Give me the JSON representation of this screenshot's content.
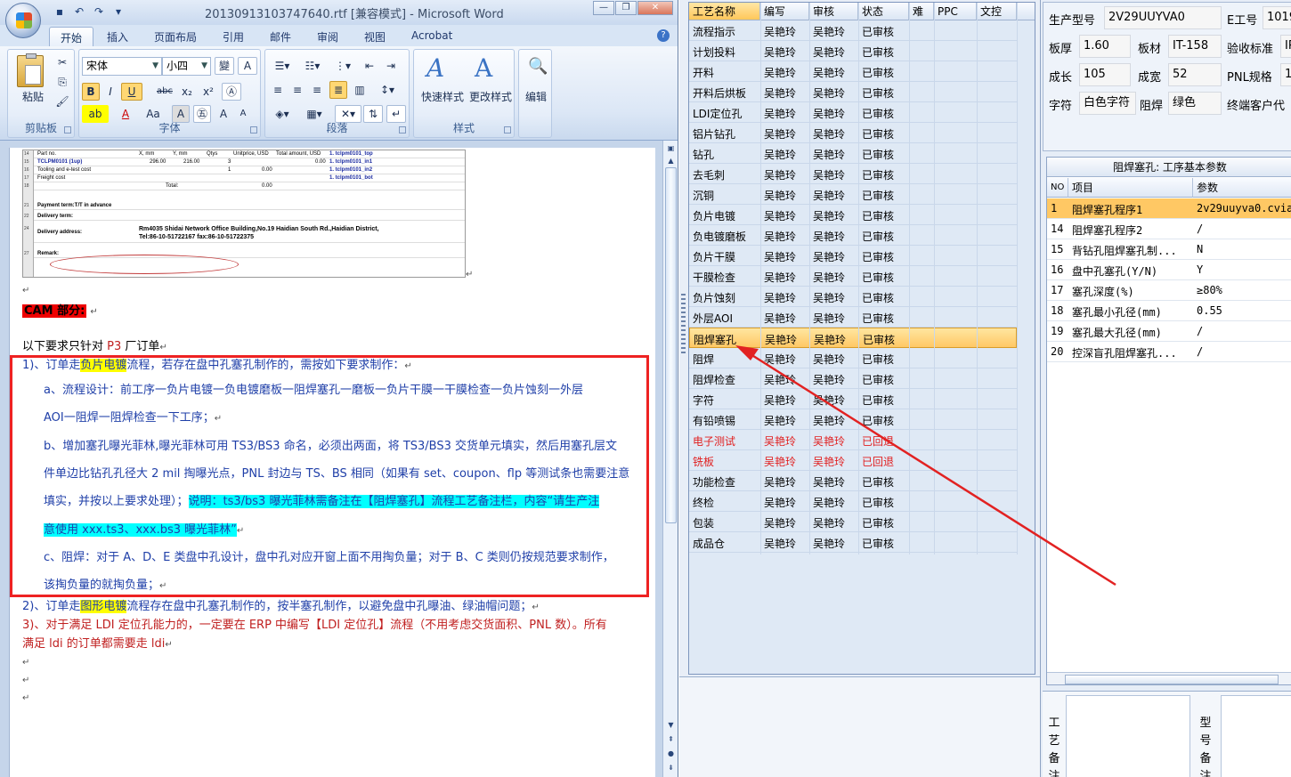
{
  "word": {
    "title": "20130913103747640.rtf [兼容模式] - Microsoft Word",
    "tabs": [
      "开始",
      "插入",
      "页面布局",
      "引用",
      "邮件",
      "审阅",
      "视图",
      "Acrobat"
    ],
    "active_tab": "开始",
    "ribbon": {
      "paste": "粘贴",
      "clipboard": "剪贴板",
      "font_name": "宋体",
      "font_size": "小四",
      "font_group": "字体",
      "paragraph_group": "段落",
      "quick_styles": "快速样式",
      "change_styles": "更改样式",
      "styles_group": "样式",
      "edit": "编辑",
      "bold": "B",
      "italic": "I",
      "underline": "U",
      "strike": "abc",
      "sub": "x₂",
      "sup": "x²",
      "font_color": "A",
      "case": "Aa",
      "grow": "A",
      "shrink": "A"
    },
    "sheet": {
      "rows": [
        {
          "n": "14",
          "cells": [
            "Part no.",
            "X, mm",
            "Y, mm",
            "Qtys",
            "Unitprice, USD",
            "Total amount, USD",
            "1. tclpm0101_top"
          ]
        },
        {
          "n": "15",
          "cells": [
            "TCLPM0101 (1up)",
            "296.00",
            "216.00",
            "3",
            "",
            "0.00",
            "1. tclpm0101_in1"
          ]
        },
        {
          "n": "16",
          "cells": [
            "Tooling and e-test cost",
            "",
            "",
            "1",
            "0.00",
            "",
            "1. tclpm0101_in2"
          ]
        },
        {
          "n": "17",
          "cells": [
            "Freight cost",
            "",
            "",
            "",
            "",
            "",
            "1. tclpm0101_bot"
          ]
        },
        {
          "n": "18",
          "cells": [
            "",
            "Total:",
            "",
            "0.00"
          ]
        },
        {
          "n": "21",
          "cells": [
            "Payment term:T/T in advance"
          ]
        },
        {
          "n": "22",
          "cells": [
            "Delivery term:"
          ]
        },
        {
          "n": "24",
          "cells": [
            "Delivery address:",
            "Rm4035 Shidai Network Office Building,No.19 Haidian South Rd.,Haidian District,",
            "Tel:86-10-51722167 fax:86-10-51722375"
          ]
        },
        {
          "n": "27",
          "cells": [
            "Remark:"
          ]
        }
      ]
    },
    "doc": {
      "cam_label": "CAM 部分:",
      "line_p3_prefix": "以下要求只针对 ",
      "line_p3_red": "P3",
      "line_p3_suffix": " 厂订单",
      "item1_prefix": "1)、订单走",
      "item1_hl": "负片电镀",
      "item1_suffix": "流程，若存在盘中孔塞孔制作的，需按如下要求制作：",
      "a_line1": "a、流程设计：前工序一负片电镀一负电镀磨板一阻焊塞孔一磨板一负片干膜一干膜检查一负片蚀刻一外层",
      "a_line2": "AOI一阻焊一阻焊检查一下工序；",
      "b_line1": "b、增加塞孔曝光菲林,曝光菲林可用 TS3/BS3 命名，必须出两面，将 TS3/BS3 交货单元填实，然后用塞孔层文",
      "b_line2": "件单边比钻孔孔径大 2 mil 掏曝光点，PNL 封边与 TS、BS 相同（如果有 set、coupon、flp 等测试条也需要注意",
      "b_line3_plain": "填实，并按以上要求处理）；",
      "b_line3_cyan": "说明：ts3/bs3 曝光菲林需备注在【阻焊塞孔】流程工艺备注栏，内容“请生产注",
      "b_line4_cyan": "意使用 xxx.ts3、xxx.bs3 曝光菲林”",
      "c_line1": "c、阻焊：对于 A、D、E 类盘中孔设计，盘中孔对应开窗上面不用掏负量；对于 B、C 类则仍按规范要求制作，",
      "c_line2": "该掏负量的就掏负量；",
      "item2_prefix": "2)、订单走",
      "item2_hl": "图形电镀",
      "item2_suffix": "流程存在盘中孔塞孔制作的，按半塞孔制作，以避免盘中孔曝油、绿油帽问题；",
      "item3_line1": "3)、对于满足 LDI 定位孔能力的，一定要在 ERP 中编写【LDI 定位孔】流程（不用考虑交货面积、PNL 数）。所有",
      "item3_line2": "满足 ldi 的订单都需要走 ldi"
    }
  },
  "process_grid": {
    "headers": [
      "工艺名称",
      "编写",
      "审核",
      "状态",
      "难",
      "PPC",
      "文控"
    ],
    "rows": [
      {
        "name": "流程指示",
        "writer": "吴艳玲",
        "reviewer": "吴艳玲",
        "status": "已审核"
      },
      {
        "name": "计划投料",
        "writer": "吴艳玲",
        "reviewer": "吴艳玲",
        "status": "已审核"
      },
      {
        "name": "开料",
        "writer": "吴艳玲",
        "reviewer": "吴艳玲",
        "status": "已审核"
      },
      {
        "name": "开料后烘板",
        "writer": "吴艳玲",
        "reviewer": "吴艳玲",
        "status": "已审核"
      },
      {
        "name": "LDI定位孔",
        "writer": "吴艳玲",
        "reviewer": "吴艳玲",
        "status": "已审核"
      },
      {
        "name": "铝片钻孔",
        "writer": "吴艳玲",
        "reviewer": "吴艳玲",
        "status": "已审核"
      },
      {
        "name": "钻孔",
        "writer": "吴艳玲",
        "reviewer": "吴艳玲",
        "status": "已审核"
      },
      {
        "name": "去毛刺",
        "writer": "吴艳玲",
        "reviewer": "吴艳玲",
        "status": "已审核"
      },
      {
        "name": "沉铜",
        "writer": "吴艳玲",
        "reviewer": "吴艳玲",
        "status": "已审核"
      },
      {
        "name": "负片电镀",
        "writer": "吴艳玲",
        "reviewer": "吴艳玲",
        "status": "已审核"
      },
      {
        "name": "负电镀磨板",
        "writer": "吴艳玲",
        "reviewer": "吴艳玲",
        "status": "已审核"
      },
      {
        "name": "负片干膜",
        "writer": "吴艳玲",
        "reviewer": "吴艳玲",
        "status": "已审核"
      },
      {
        "name": "干膜检查",
        "writer": "吴艳玲",
        "reviewer": "吴艳玲",
        "status": "已审核"
      },
      {
        "name": "负片蚀刻",
        "writer": "吴艳玲",
        "reviewer": "吴艳玲",
        "status": "已审核"
      },
      {
        "name": "外层AOI",
        "writer": "吴艳玲",
        "reviewer": "吴艳玲",
        "status": "已审核"
      },
      {
        "name": "阻焊塞孔",
        "writer": "吴艳玲",
        "reviewer": "吴艳玲",
        "status": "已审核"
      },
      {
        "name": "阻焊",
        "writer": "吴艳玲",
        "reviewer": "吴艳玲",
        "status": "已审核"
      },
      {
        "name": "阻焊检查",
        "writer": "吴艳玲",
        "reviewer": "吴艳玲",
        "status": "已审核"
      },
      {
        "name": "字符",
        "writer": "吴艳玲",
        "reviewer": "吴艳玲",
        "status": "已审核"
      },
      {
        "name": "有铅喷锡",
        "writer": "吴艳玲",
        "reviewer": "吴艳玲",
        "status": "已审核"
      },
      {
        "name": "电子测试",
        "writer": "吴艳玲",
        "reviewer": "吴艳玲",
        "status": "已回退"
      },
      {
        "name": "铣板",
        "writer": "吴艳玲",
        "reviewer": "吴艳玲",
        "status": "已回退"
      },
      {
        "name": "功能检查",
        "writer": "吴艳玲",
        "reviewer": "吴艳玲",
        "status": "已审核"
      },
      {
        "name": "终检",
        "writer": "吴艳玲",
        "reviewer": "吴艳玲",
        "status": "已审核"
      },
      {
        "name": "包装",
        "writer": "吴艳玲",
        "reviewer": "吴艳玲",
        "status": "已审核"
      },
      {
        "name": "成品仓",
        "writer": "吴艳玲",
        "reviewer": "吴艳玲",
        "status": "已审核"
      }
    ],
    "selected_row": "阻焊塞孔"
  },
  "info": {
    "model_label": "生产型号",
    "model": "2V29UUYVA0",
    "eno_label": "E工号",
    "eno": "1019",
    "thickness_label": "板厚",
    "thickness": "1.60",
    "material_label": "板材",
    "material": "IT-158",
    "standard_label": "验收标准",
    "standard": "IP",
    "length_label": "成长",
    "length": "105",
    "width_label": "成宽",
    "width": "52",
    "pnl_label": "PNL规格",
    "pnl": "1",
    "char_label": "字符",
    "char": "白色字符",
    "mask_label": "阻焊",
    "mask": "绿色",
    "enduser_label": "终端客户代"
  },
  "params": {
    "title": "阻焊塞孔: 工序基本参数",
    "headers": [
      "NO",
      "项目",
      "参数"
    ],
    "rows": [
      {
        "no": "1",
        "item": "阻焊塞孔程序1",
        "value": "2v29uuyva0.cvia"
      },
      {
        "no": "14",
        "item": "阻焊塞孔程序2",
        "value": "/"
      },
      {
        "no": "15",
        "item": "背钻孔阻焊塞孔制...",
        "value": "N"
      },
      {
        "no": "16",
        "item": "盘中孔塞孔(Y/N)",
        "value": "Y"
      },
      {
        "no": "17",
        "item": "塞孔深度(%)",
        "value": "≥80%"
      },
      {
        "no": "18",
        "item": "塞孔最小孔径(mm)",
        "value": "0.55"
      },
      {
        "no": "19",
        "item": "塞孔最大孔径(mm)",
        "value": "/"
      },
      {
        "no": "20",
        "item": "控深盲孔阻焊塞孔...",
        "value": "/"
      }
    ]
  },
  "bottom": {
    "left_label": "工艺备注",
    "right_label": "型号备注"
  },
  "colors": {
    "accent_red": "#e22222",
    "selected_row": "#ffc865",
    "ribbon_blue": "#c5d5ea"
  },
  "icons": [
    "office-button-icon",
    "save-icon",
    "undo-icon",
    "redo-icon",
    "help-icon",
    "paste-icon",
    "arrow-annotation"
  ]
}
